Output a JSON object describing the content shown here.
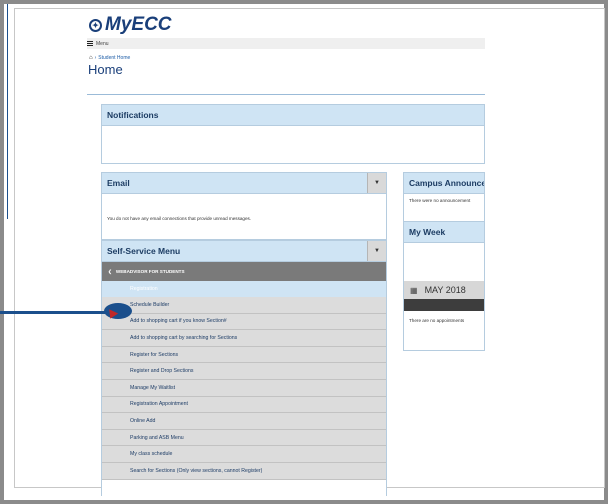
{
  "app": {
    "logo_text": "MyECC"
  },
  "menu_bar": {
    "label": "Menu"
  },
  "breadcrumb": {
    "item": "Student Home"
  },
  "page": {
    "title": "Home"
  },
  "notifications": {
    "title": "Notifications"
  },
  "email": {
    "title": "Email",
    "message": "You do not have any email connections that provide unread messages."
  },
  "campus": {
    "title": "Campus Announcem",
    "message": "There were no announcement"
  },
  "my_week": {
    "title": "My Week",
    "month": "MAY 2018",
    "message": "There are no appointments"
  },
  "self_service": {
    "title": "Self-Service Menu",
    "submenu_title": "WEBADVISOR FOR STUDENTS",
    "items": [
      {
        "label": "Registration",
        "active": true
      },
      {
        "label": "Schedule Builder"
      },
      {
        "label": "Add to shopping cart if you know Section#"
      },
      {
        "label": "Add to shopping cart by searching for Sections"
      },
      {
        "label": "Register for Sections"
      },
      {
        "label": "Register and Drop Sections"
      },
      {
        "label": "Manage My Waitlist"
      },
      {
        "label": "Registration Appointment"
      },
      {
        "label": "Online Add"
      },
      {
        "label": "Parking and ASB Menu"
      },
      {
        "label": "My class schedule"
      },
      {
        "label": "Search for Sections (Only view sections, cannot Register)"
      }
    ]
  },
  "colors": {
    "brand": "#1a3f7a",
    "panel_header": "#cfe4f4",
    "pointer": "#1b4f8c"
  }
}
